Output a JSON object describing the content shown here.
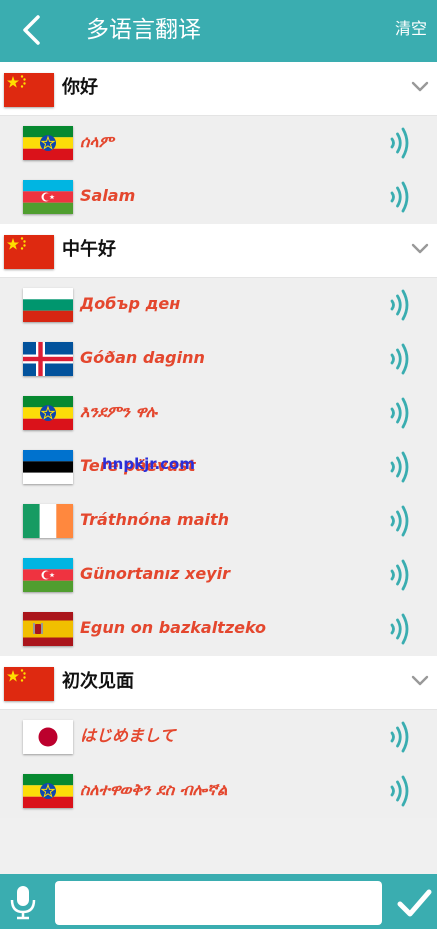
{
  "header": {
    "title": "多语言翻译",
    "clear_label": "清空"
  },
  "groups": [
    {
      "source": "你好",
      "source_flag": "china-flag-icon",
      "items": [
        {
          "flag": "ethiopia-flag-icon",
          "text": "ሰላም"
        },
        {
          "flag": "azerbaijan-flag-icon",
          "text": "Salam"
        }
      ]
    },
    {
      "source": "中午好",
      "source_flag": "china-flag-icon",
      "items": [
        {
          "flag": "bulgaria-flag-icon",
          "text": "Добър ден"
        },
        {
          "flag": "iceland-flag-icon",
          "text": "Góðan daginn"
        },
        {
          "flag": "ethiopia-flag-icon",
          "text": "እንደምን ዋሉ"
        },
        {
          "flag": "estonia-flag-icon",
          "text": "Tere päevast"
        },
        {
          "flag": "ireland-flag-icon",
          "text": "Tráthnóna maith"
        },
        {
          "flag": "azerbaijan-flag-icon",
          "text": "Günortanız xeyir"
        },
        {
          "flag": "spain-flag-icon",
          "text": "Egun on bazkaltzeko"
        }
      ]
    },
    {
      "source": "初次见面",
      "source_flag": "china-flag-icon",
      "items": [
        {
          "flag": "japan-flag-icon",
          "text": "はじめまして"
        },
        {
          "flag": "ethiopia-flag-icon",
          "text": "ስለተዋወቅን ደስ ብሎኛል"
        }
      ]
    }
  ],
  "watermark": "hnpkjr.com",
  "input": {
    "value": ""
  },
  "colors": {
    "accent": "#3aadb0",
    "translation": "#e4472e"
  },
  "icons": {
    "back": "back-arrow-icon",
    "chevron": "chevron-down-icon",
    "speaker": "speaker-icon",
    "mic": "microphone-icon",
    "send": "checkmark-icon"
  }
}
